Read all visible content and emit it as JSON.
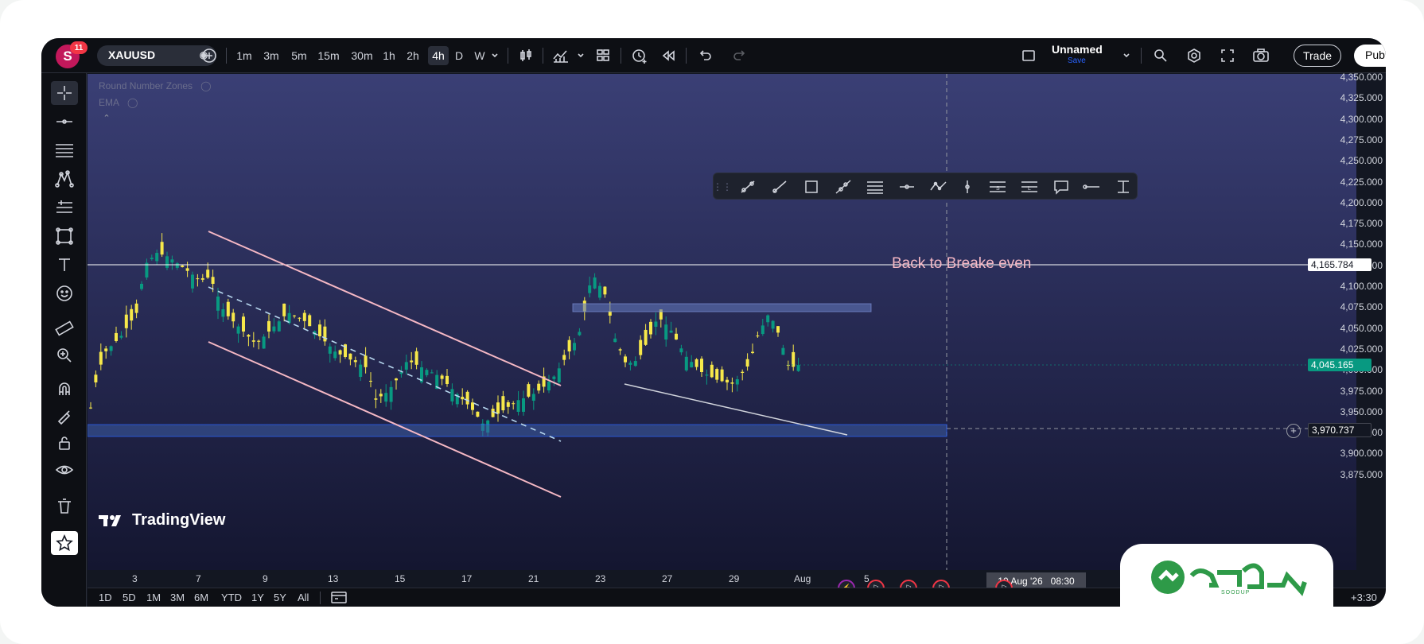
{
  "topbar": {
    "avatar_letter": "S",
    "notifications": "11",
    "symbol": "XAUUSD",
    "intervals": [
      "1m",
      "3m",
      "5m",
      "15m",
      "30m",
      "1h",
      "2h",
      "4h",
      "D",
      "W"
    ],
    "active_interval": "4h",
    "layout_name": "Unnamed",
    "layout_save": "Save",
    "trade_label": "Trade",
    "publish_label": "Pub"
  },
  "indicators": [
    {
      "label": "Round Number Zones"
    },
    {
      "label": "EMA"
    }
  ],
  "annotation": "Back to Breake even",
  "watermark": "TradingView",
  "price_axis": {
    "ticks": [
      "4,350.000",
      "4,325.000",
      "4,300.000",
      "4,275.000",
      "4,250.000",
      "4,225.000",
      "4,200.000",
      "4,175.000",
      "4,150.000",
      "4,125.000",
      "4,100.000",
      "4,075.000",
      "4,050.000",
      "4,025.000",
      "4,000.000",
      "3,975.000",
      "3,950.000",
      "3,925.000",
      "3,900.000",
      "3,875.000"
    ],
    "horizontal_line_label": "4,165.784",
    "current_price_label": "4,045.165",
    "crosshair_price_label": "3,970.737",
    "current_price_color": "#089981"
  },
  "time_axis": {
    "ticks": [
      "3",
      "7",
      "9",
      "13",
      "15",
      "17",
      "21",
      "23",
      "27",
      "29",
      "Aug",
      "5"
    ],
    "crosshair_date": "10 Aug '26",
    "crosshair_time": "08:30"
  },
  "bottombar": {
    "ranges": [
      "1D",
      "5D",
      "1M",
      "3M",
      "6M",
      "YTD",
      "1Y",
      "5Y",
      "All"
    ],
    "timezone": "+3:30"
  },
  "brand": {
    "name": "SOODUP",
    "color": "#2e9a48"
  },
  "colors": {
    "bull": "#089981",
    "bear": "#f7e84a",
    "channel": "#f5b8c4",
    "zone": "#3d5fa8",
    "annotation": "#f5b8c4"
  }
}
